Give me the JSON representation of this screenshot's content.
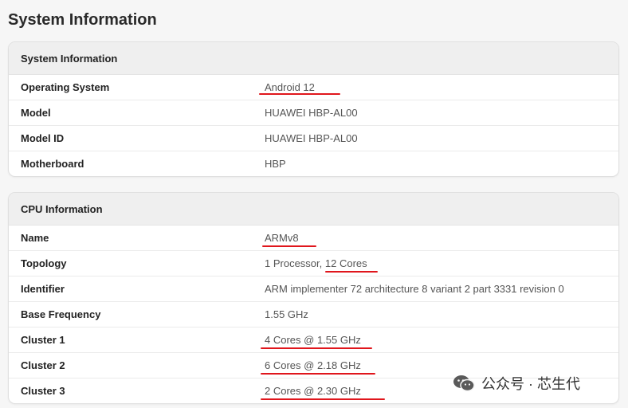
{
  "page": {
    "title": "System Information"
  },
  "system_card": {
    "header": "System Information",
    "rows": [
      {
        "label": "Operating System",
        "value": "Android 12"
      },
      {
        "label": "Model",
        "value": "HUAWEI HBP-AL00"
      },
      {
        "label": "Model ID",
        "value": "HUAWEI HBP-AL00"
      },
      {
        "label": "Motherboard",
        "value": "HBP"
      }
    ]
  },
  "cpu_card": {
    "header": "CPU Information",
    "rows": [
      {
        "label": "Name",
        "value": "ARMv8"
      },
      {
        "label": "Topology",
        "value_prefix": "1 Processor, ",
        "value_highlight": "12 Cores"
      },
      {
        "label": "Identifier",
        "value": "ARM implementer 72 architecture 8 variant 2 part 3331 revision 0"
      },
      {
        "label": "Base Frequency",
        "value": "1.55 GHz"
      },
      {
        "label": "Cluster 1",
        "value": "4 Cores @ 1.55 GHz"
      },
      {
        "label": "Cluster 2",
        "value": "6 Cores @ 2.18 GHz"
      },
      {
        "label": "Cluster 3",
        "value": "2 Cores @ 2.30 GHz"
      }
    ]
  },
  "watermark": {
    "text": "公众号 · 芯生代",
    "icon": "wechat-icon"
  },
  "colors": {
    "annotation": "#e0161c",
    "header_bg": "#efefef"
  }
}
